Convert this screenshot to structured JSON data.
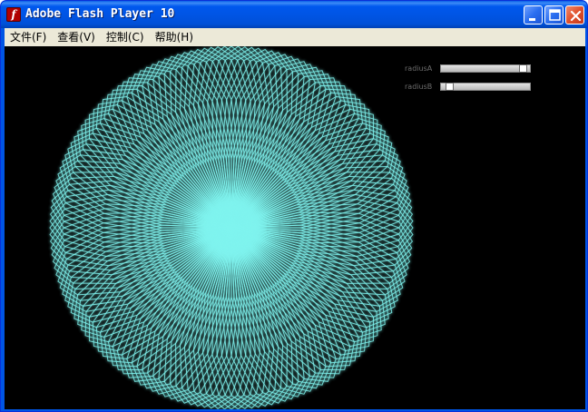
{
  "window": {
    "title": "Adobe Flash Player 10",
    "app_icon_glyph": "f",
    "controls": [
      "minimize-icon",
      "maximize-icon",
      "close-icon"
    ]
  },
  "menu": {
    "items": [
      {
        "label": "文件(F)"
      },
      {
        "label": "查看(V)"
      },
      {
        "label": "控制(C)"
      },
      {
        "label": "帮助(H)"
      }
    ]
  },
  "stage": {
    "background": "#000000",
    "line_color": "#7ff3ee",
    "sliders": [
      {
        "label": "radiusA",
        "value": 0.95
      },
      {
        "label": "radiusB",
        "value": 0.05
      }
    ],
    "pattern": {
      "type": "rotating-hypotrochoid-rosette",
      "curves": 24,
      "symmetry": 7
    }
  },
  "colors": {
    "titlebar": "#0054e3",
    "menubar": "#ece9d8",
    "close_button": "#e0512c"
  }
}
